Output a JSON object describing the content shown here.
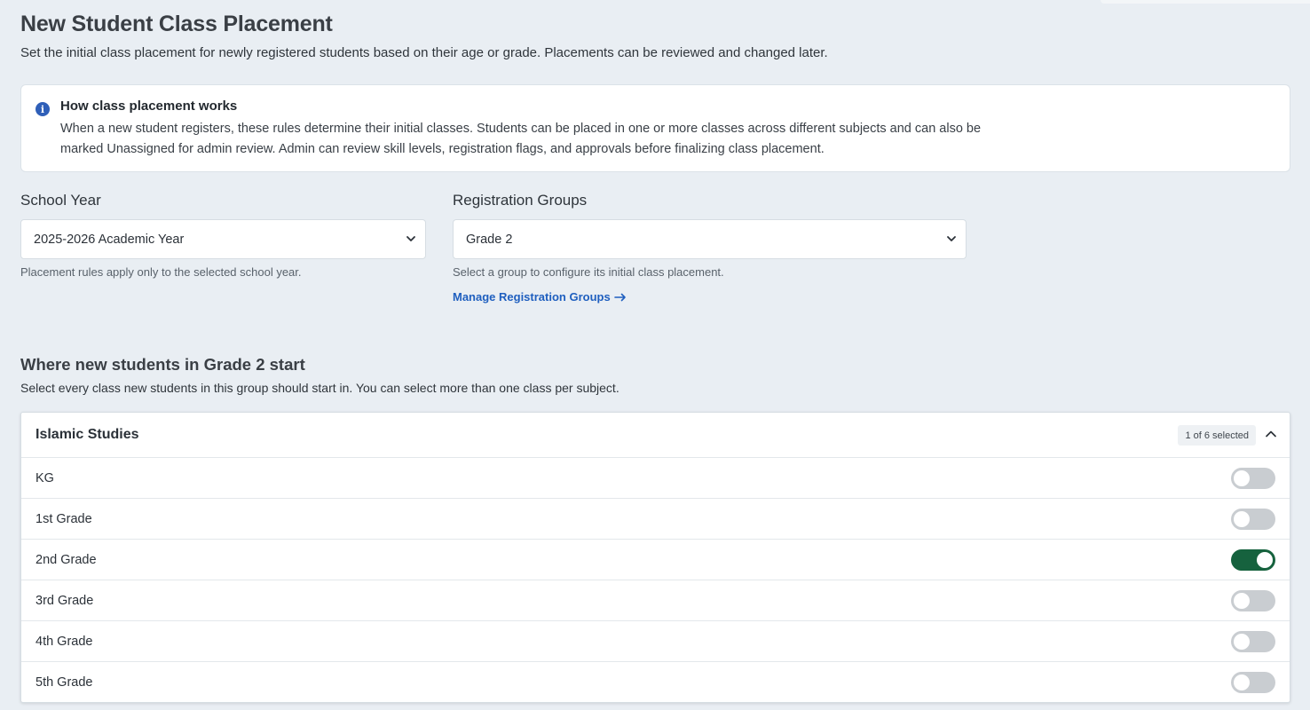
{
  "header": {
    "title": "New Student Class Placement",
    "subtitle": "Set the initial class placement for newly registered students based on their age or grade. Placements can be reviewed and changed later."
  },
  "info": {
    "title": "How class placement works",
    "text": "When a new student registers, these rules determine their initial classes. Students can be placed in one or more classes across different subjects and can also be marked Unassigned for admin review. Admin can review skill levels, registration flags, and approvals before finalizing class placement.",
    "icon": "info-icon"
  },
  "school_year": {
    "label": "School Year",
    "value": "2025-2026 Academic Year",
    "help": "Placement rules apply only to the selected school year."
  },
  "registration_groups": {
    "label": "Registration Groups",
    "value": "Grade 2",
    "help": "Select a group to configure its initial class placement.",
    "manage_link": "Manage Registration Groups"
  },
  "section": {
    "title": "Where new students in Grade 2 start",
    "subtitle": "Select every class new students in this group should start in. You can select more than one class per subject."
  },
  "subject_panel": {
    "title": "Islamic Studies",
    "count_badge": "1 of 6 selected",
    "classes": [
      {
        "label": "KG",
        "selected": false
      },
      {
        "label": "1st Grade",
        "selected": false
      },
      {
        "label": "2nd Grade",
        "selected": true
      },
      {
        "label": "3rd Grade",
        "selected": false
      },
      {
        "label": "4th Grade",
        "selected": false
      },
      {
        "label": "5th Grade",
        "selected": false
      }
    ]
  },
  "colors": {
    "accent_link": "#1f5fbf",
    "toggle_on": "#16623e",
    "toggle_off": "#c9cdd1",
    "background": "#e9eef3"
  }
}
